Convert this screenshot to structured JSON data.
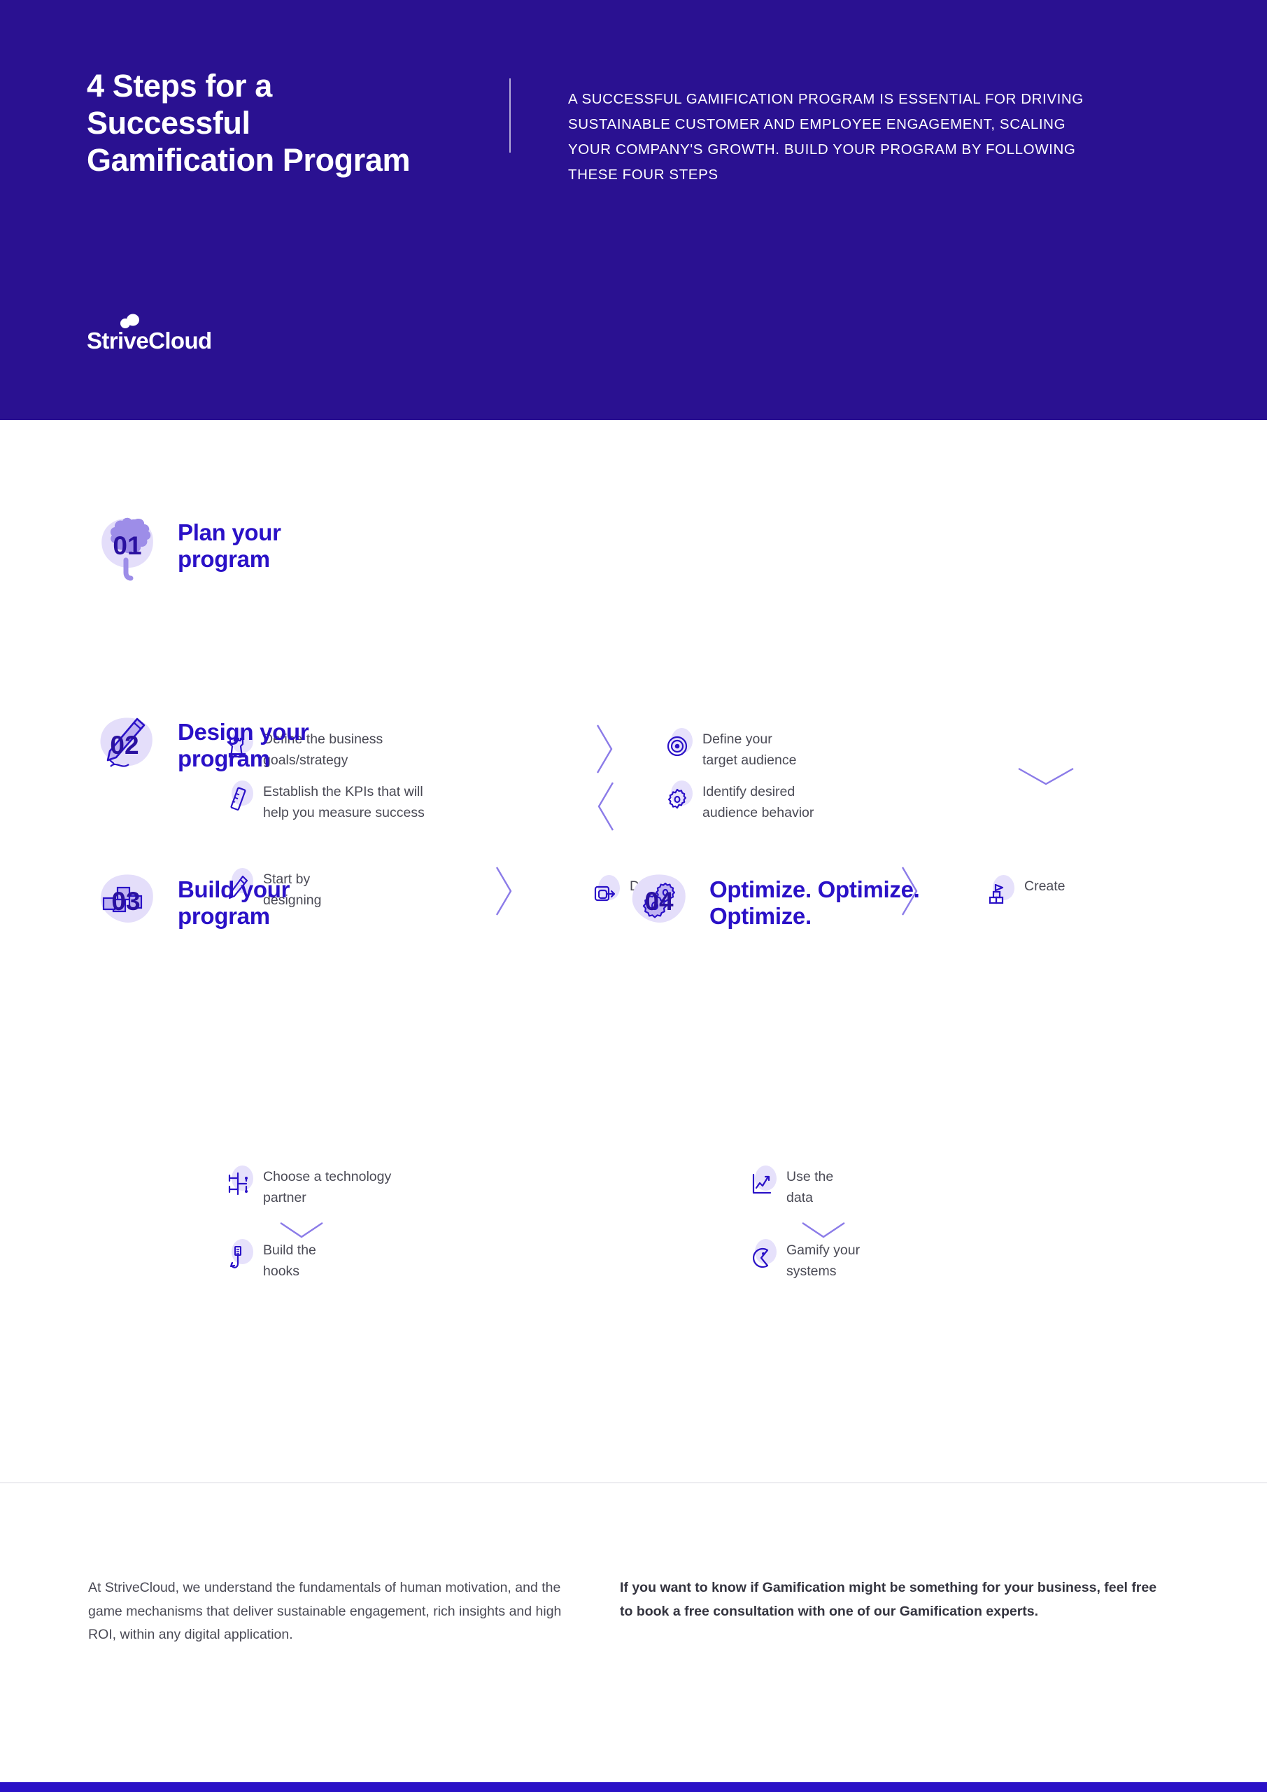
{
  "header": {
    "title": "4 Steps for a Successful Gamification Program",
    "intro": "A SUCCESSFUL GAMIFICATION PROGRAM IS ESSENTIAL FOR DRIVING SUSTAINABLE CUSTOMER AND EMPLOYEE ENGAGEMENT, SCALING YOUR COMPANY'S GROWTH. BUILD YOUR PROGRAM BY FOLLOWING THESE FOUR STEPS",
    "logo_text": "StriveCloud",
    "logo_icon": "cloud-dots-icon",
    "background_color": "#2A1191",
    "text_color": "#FFFFFF"
  },
  "steps": [
    {
      "number": "01",
      "badge_icon": "brain-icon",
      "title": "Plan your\nprogram",
      "items": [
        {
          "label": "Define the business\ngoals/strategy",
          "icon": "chess-rook-icon"
        },
        {
          "label": "Define your\ntarget audience",
          "icon": "target-icon"
        },
        {
          "label": "Establish the KPIs that will\nhelp you measure success",
          "icon": "ruler-icon"
        },
        {
          "label": "Identify desired\naudience behavior",
          "icon": "gear-icon"
        }
      ]
    },
    {
      "number": "02",
      "badge_icon": "pencil-icon",
      "title": "Design your\nprogram",
      "items": [
        {
          "label": "Start by\ndesigning",
          "icon": "pencil-small-icon"
        },
        {
          "label": "Decide",
          "icon": "export-arrow-icon"
        },
        {
          "label": "Create",
          "icon": "blocks-flag-icon"
        }
      ]
    },
    {
      "number": "03",
      "badge_icon": "building-blocks-icon",
      "title": "Build your\nprogram",
      "items": [
        {
          "label": "Choose a technology\npartner",
          "icon": "circuit-icon"
        },
        {
          "label": "Build the\nhooks",
          "icon": "fish-hook-icon"
        }
      ]
    },
    {
      "number": "04",
      "badge_icon": "gears-icon",
      "title": "Optimize. Optimize.\nOptimize.",
      "items": [
        {
          "label": "Use the\ndata",
          "icon": "line-chart-icon"
        },
        {
          "label": "Gamify your\nsystems",
          "icon": "pacman-icon"
        }
      ]
    }
  ],
  "footer": {
    "left_text": "At StriveCloud, we understand the fundamentals of human motivation, and the game mechanisms that deliver sustainable engagement, rich insights and high ROI, within any digital application.",
    "right_text": "If you want to know if Gamification might be something for your business, feel free to book a free consultation with one of our Gamification experts."
  },
  "colors": {
    "brand_blue": "#2A11C7",
    "header_bg": "#2A1191",
    "accent_light": "#8B7BE8",
    "blob_light": "#E6E1FB",
    "body_text": "#4A4A55"
  }
}
